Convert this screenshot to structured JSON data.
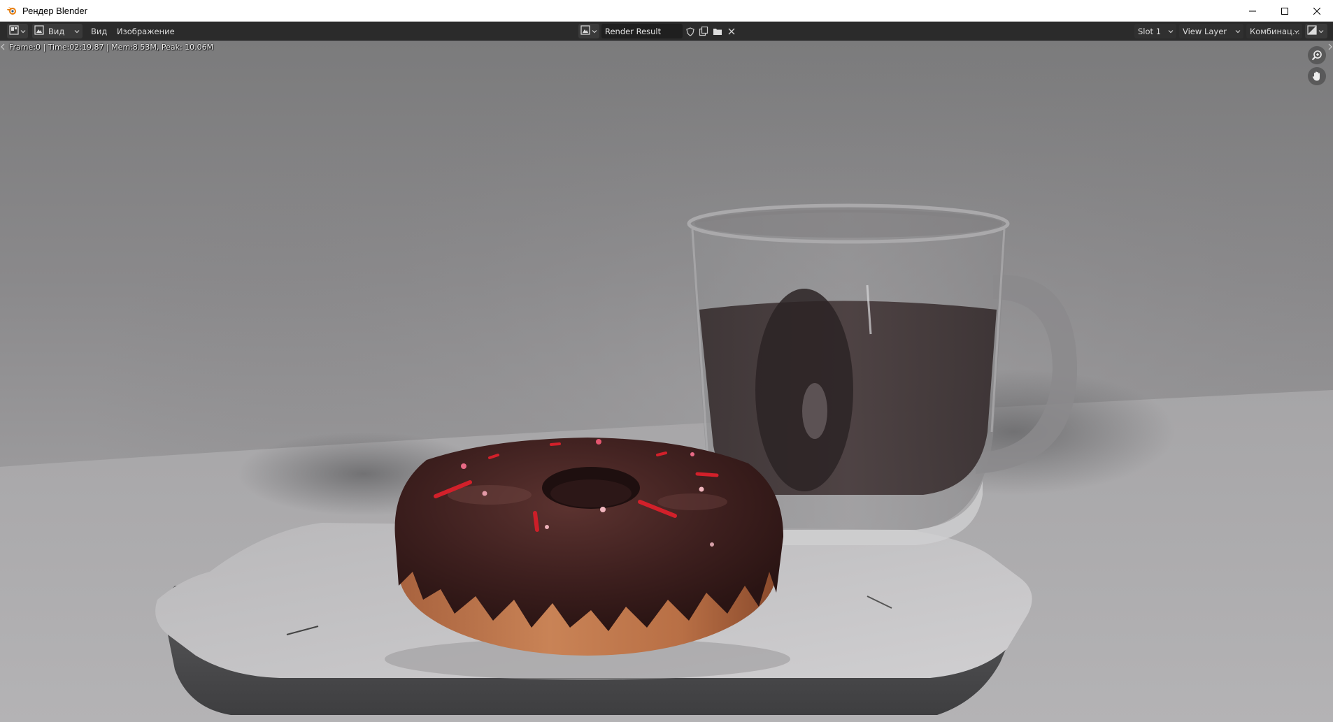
{
  "window": {
    "title": "Рендер Blender",
    "controls": [
      "minimize",
      "maximize",
      "close"
    ]
  },
  "header": {
    "editor_type_icon": "image-editor-icon",
    "view_mode": "Вид",
    "menus": {
      "view": "Вид",
      "image": "Изображение"
    },
    "image": {
      "browse_icon": "image-browse-icon",
      "name": "Render Result",
      "fake_user_icon": "shield-icon",
      "new_icon": "new-image-icon",
      "open_icon": "folder-icon",
      "unlink_icon": "close-icon"
    },
    "slot": "Slot 1",
    "view_layer": "View Layer",
    "pass": "Комбинац...",
    "display_icon": "display-channels-icon"
  },
  "viewport": {
    "stats": "Frame:0 | Time:02:19.87 | Mem:8.53M, Peak: 10.06M",
    "gizmos": [
      "zoom-icon",
      "pan-hand-icon"
    ],
    "render_content": "donut-and-mug-render"
  },
  "colors": {
    "titlebar_bg": "#ffffff",
    "header_bg": "#2b2b2b",
    "field_bg": "#1f1f1f",
    "text": "#dcdcdc",
    "blender_orange": "#e87d0d"
  }
}
